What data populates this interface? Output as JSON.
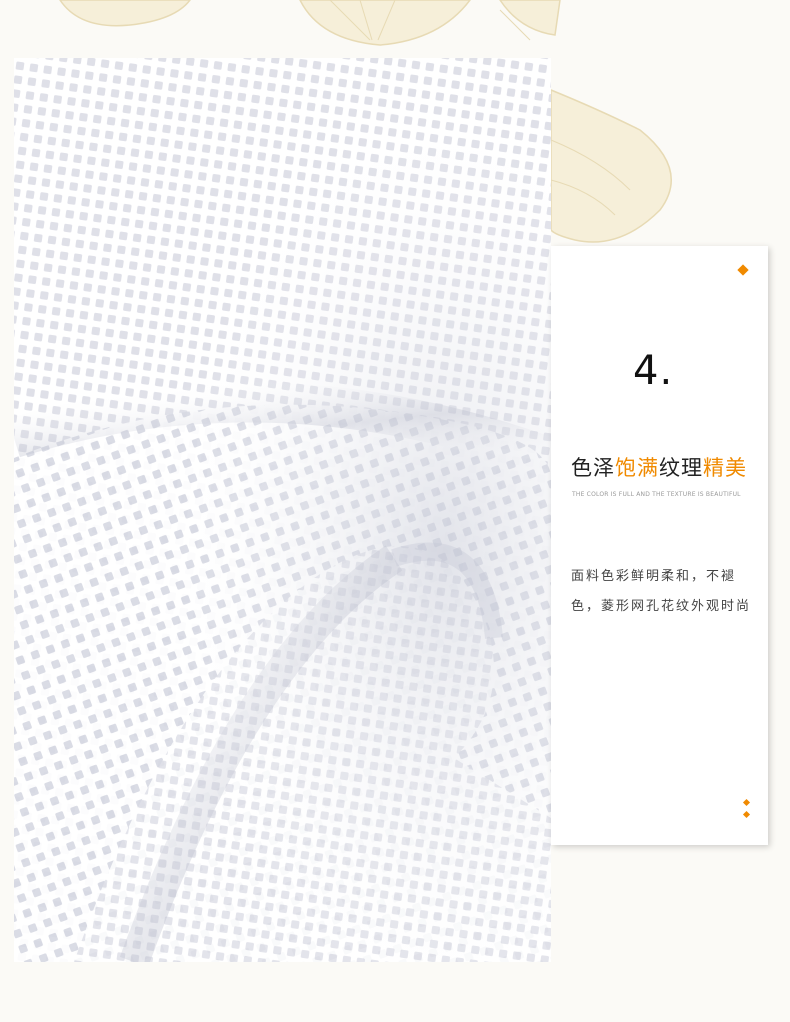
{
  "card": {
    "number": "4.",
    "headline_part1": "色泽",
    "headline_part2": "饱满",
    "headline_part3": "纹理",
    "headline_part4": "精美",
    "subtitle": "THE COLOR IS FULL AND THE TEXTURE IS BEAUTIFUL",
    "description": "面料色彩鲜明柔和，不褪色，菱形网孔花纹外观时尚"
  },
  "colors": {
    "accent": "#f08a00",
    "text": "#222222",
    "background": "#fbfaf6",
    "card": "#ffffff"
  },
  "icons": [
    "ginkgo-leaf-decoration",
    "diamond-bullet-icon"
  ]
}
